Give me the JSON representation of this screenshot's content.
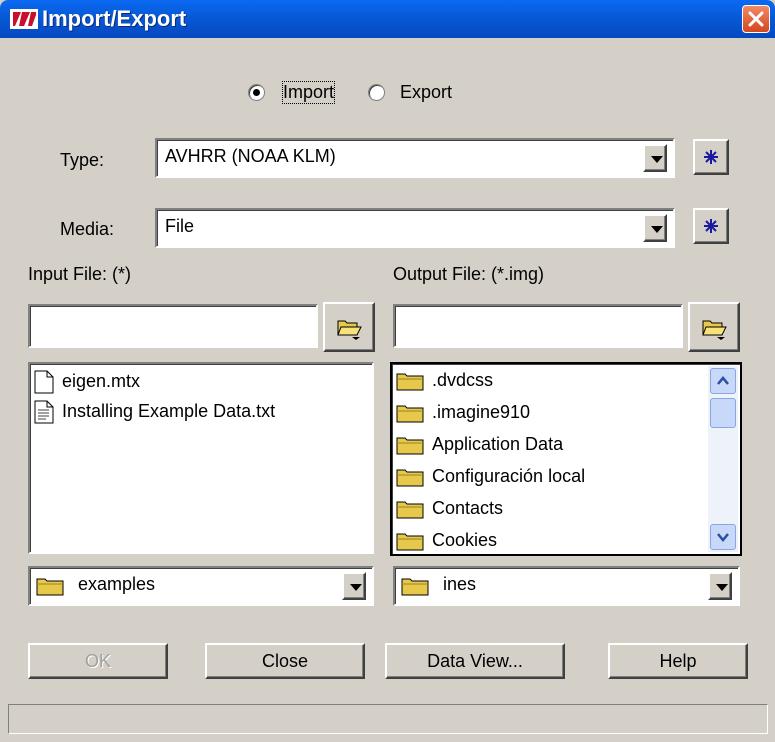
{
  "window": {
    "title": "Import/Export",
    "close_icon": "close-icon"
  },
  "mode": {
    "import_label": "Import",
    "export_label": "Export",
    "selected": "Import"
  },
  "type": {
    "label": "Type:",
    "value": "AVHRR (NOAA KLM)"
  },
  "media": {
    "label": "Media:",
    "value": "File"
  },
  "input": {
    "label": "Input File: (*)",
    "value": "",
    "files": [
      {
        "name": "eigen.mtx",
        "icon": "file-icon"
      },
      {
        "name": "Installing Example Data.txt",
        "icon": "text-file-icon"
      }
    ],
    "directory": "examples"
  },
  "output": {
    "label": "Output File: (*.img)",
    "value": "",
    "folders": [
      ".dvdcss",
      ".imagine910",
      "Application Data",
      "Configuración local",
      "Contacts",
      "Cookies"
    ],
    "directory": "ines"
  },
  "buttons": {
    "ok": "OK",
    "close": "Close",
    "data_view": "Data View...",
    "help": "Help"
  },
  "status": ""
}
